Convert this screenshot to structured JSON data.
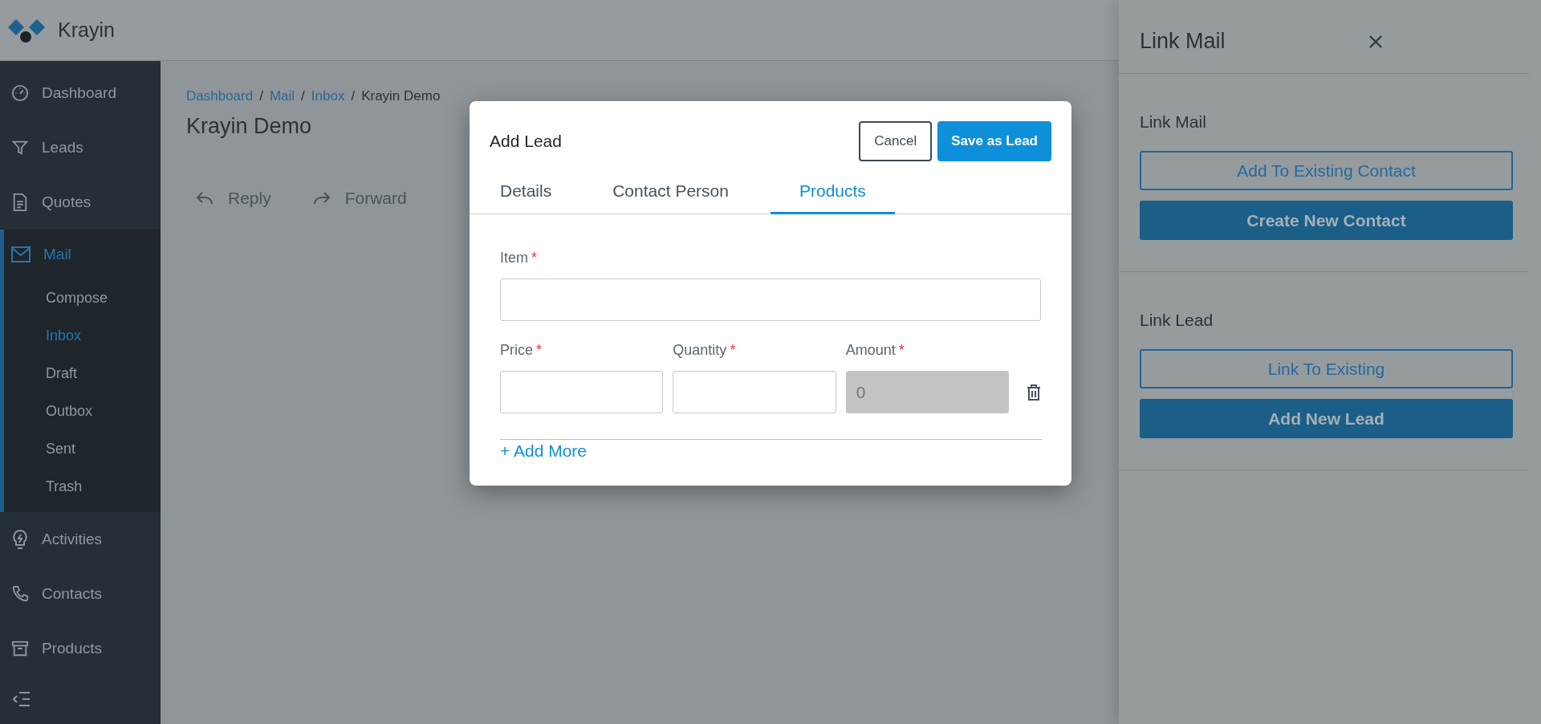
{
  "brand": {
    "name": "Krayin"
  },
  "sidebar": {
    "items": [
      {
        "label": "Dashboard",
        "selected": false
      },
      {
        "label": "Leads",
        "selected": false
      },
      {
        "label": "Quotes",
        "selected": false
      },
      {
        "label": "Mail",
        "selected": true,
        "expanded": true,
        "children": [
          {
            "label": "Compose",
            "selected": false
          },
          {
            "label": "Inbox",
            "selected": true
          },
          {
            "label": "Draft",
            "selected": false
          },
          {
            "label": "Outbox",
            "selected": false
          },
          {
            "label": "Sent",
            "selected": false
          },
          {
            "label": "Trash",
            "selected": false
          }
        ]
      },
      {
        "label": "Activities",
        "selected": false
      },
      {
        "label": "Contacts",
        "selected": false
      },
      {
        "label": "Products",
        "selected": false
      }
    ]
  },
  "breadcrumb": [
    {
      "label": "Dashboard",
      "kind": "link"
    },
    {
      "separator": "/",
      "label": "Mail",
      "kind": "link"
    },
    {
      "separator": "/",
      "label": "Inbox",
      "kind": "link"
    },
    {
      "separator": "/",
      "label": "Krayin Demo",
      "kind": "current"
    }
  ],
  "page_title": "Krayin Demo",
  "actions": [
    {
      "label": "Reply",
      "kind": "reply"
    },
    {
      "label": "Forward",
      "kind": "forward"
    }
  ],
  "modal": {
    "title": "Add Lead",
    "buttons": [
      {
        "label": "Cancel",
        "kind": "secondary"
      },
      {
        "label": "Save as Lead",
        "kind": "primary"
      }
    ],
    "tabs": [
      {
        "label": "Details",
        "selected": false
      },
      {
        "label": "Contact Person",
        "selected": false
      },
      {
        "label": "Products",
        "selected": true
      }
    ],
    "item_field": {
      "label": "Item",
      "mark": "*",
      "disabled": false
    },
    "row_fields": [
      {
        "label": "Price",
        "mark": "*",
        "disabled": false
      },
      {
        "label": "Quantity",
        "mark": "*",
        "disabled": false
      },
      {
        "label": "Amount",
        "mark": "*",
        "disabled": true,
        "value": "0"
      }
    ],
    "add_more": "+ Add More"
  },
  "right_panel": {
    "title": "Link Mail",
    "sections": [
      {
        "title": "Link Mail",
        "buttons": [
          {
            "label": "Add To Existing Contact",
            "kind": "outline"
          },
          {
            "label": "Create New Contact",
            "kind": "filled"
          }
        ]
      },
      {
        "title": "Link Lead",
        "buttons": [
          {
            "label": "Link To Existing",
            "kind": "outline"
          },
          {
            "label": "Add New Lead",
            "kind": "filled"
          }
        ]
      }
    ]
  }
}
